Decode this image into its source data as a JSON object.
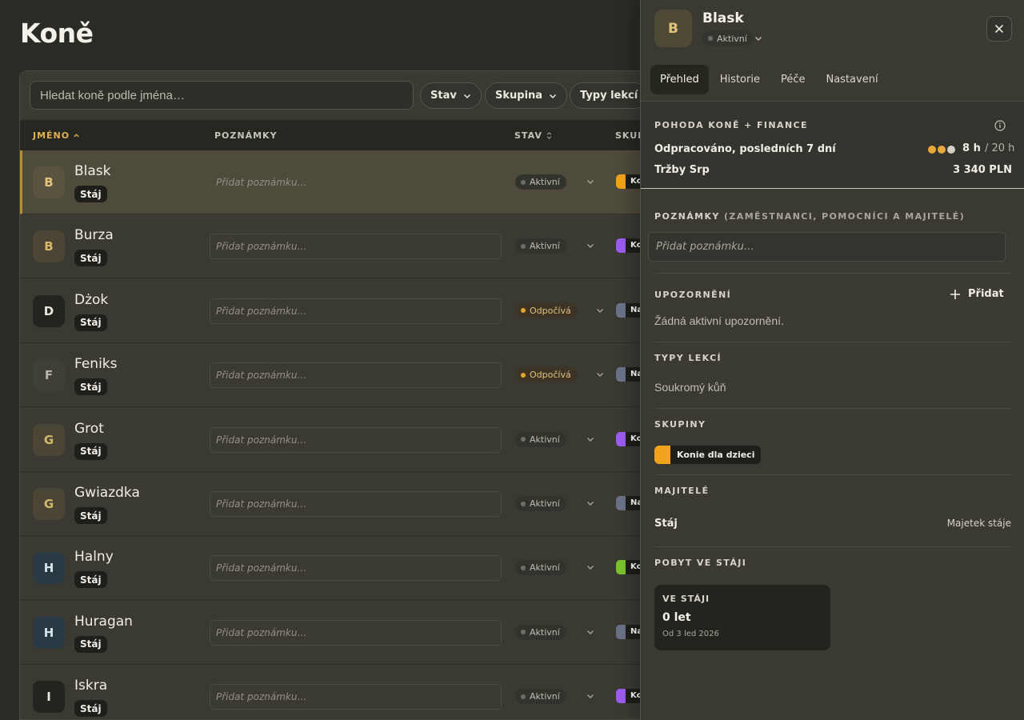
{
  "page": {
    "title": "Koně"
  },
  "toolbar": {
    "search_placeholder": "Hledat koně podle jména…",
    "filters": [
      "Stav",
      "Skupina",
      "Typy lekcí"
    ]
  },
  "table": {
    "columns": {
      "name": "JMÉNO",
      "notes": "POZNÁMKY",
      "status": "STAV",
      "group": "SKUP"
    },
    "note_placeholder": "Přidat poznámku…",
    "rows": [
      {
        "initial": "B",
        "name": "Blask",
        "tag": "Stáj",
        "status": "Aktivní",
        "status_kind": "active",
        "group_label": "Ko",
        "group_color": "#f2a31c",
        "avatar_bg": "#5a5340",
        "avatar_fg": "#e4c27a",
        "selected": true
      },
      {
        "initial": "B",
        "name": "Burza",
        "tag": "Stáj",
        "status": "Aktivní",
        "status_kind": "active",
        "group_label": "Ko",
        "group_color": "#9b5cf0",
        "avatar_bg": "#4a4534",
        "avatar_fg": "#d9b867",
        "selected": false
      },
      {
        "initial": "D",
        "name": "Dżok",
        "tag": "Stáj",
        "status": "Odpočívá",
        "status_kind": "rest",
        "group_label": "Na",
        "group_color": "#6b7287",
        "avatar_bg": "#24241f",
        "avatar_fg": "#e9e6dc",
        "selected": false
      },
      {
        "initial": "F",
        "name": "Feniks",
        "tag": "Stáj",
        "status": "Odpočívá",
        "status_kind": "rest",
        "group_label": "Na",
        "group_color": "#6b7287",
        "avatar_bg": "#3f3f38",
        "avatar_fg": "#b8b4a8",
        "selected": false
      },
      {
        "initial": "G",
        "name": "Grot",
        "tag": "Stáj",
        "status": "Aktivní",
        "status_kind": "active",
        "group_label": "Ko",
        "group_color": "#9b5cf0",
        "avatar_bg": "#4a4534",
        "avatar_fg": "#d9b867",
        "selected": false
      },
      {
        "initial": "G",
        "name": "Gwiazdka",
        "tag": "Stáj",
        "status": "Aktivní",
        "status_kind": "active",
        "group_label": "Na",
        "group_color": "#6b7287",
        "avatar_bg": "#4a4534",
        "avatar_fg": "#d9b867",
        "selected": false
      },
      {
        "initial": "H",
        "name": "Halny",
        "tag": "Stáj",
        "status": "Aktivní",
        "status_kind": "active",
        "group_label": "Ko",
        "group_color": "#7cc42a",
        "avatar_bg": "#2a3a44",
        "avatar_fg": "#d8e4ea",
        "selected": false
      },
      {
        "initial": "H",
        "name": "Huragan",
        "tag": "Stáj",
        "status": "Aktivní",
        "status_kind": "active",
        "group_label": "Na",
        "group_color": "#6b7287",
        "avatar_bg": "#2a3a44",
        "avatar_fg": "#d8e4ea",
        "selected": false
      },
      {
        "initial": "I",
        "name": "Iskra",
        "tag": "Stáj",
        "status": "Aktivní",
        "status_kind": "active",
        "group_label": "Ko",
        "group_color": "#9b5cf0",
        "avatar_bg": "#24241f",
        "avatar_fg": "#e9e6dc",
        "selected": false
      }
    ]
  },
  "panel": {
    "initial": "B",
    "name": "Blask",
    "status": "Aktivní",
    "tabs": [
      "Přehled",
      "Historie",
      "Péče",
      "Nastavení"
    ],
    "active_tab": 0,
    "wellness": {
      "title": "POHODA KONĚ + FINANCE",
      "worked_label": "Odpracováno, posledních 7 dní",
      "worked_hours": "8 h",
      "worked_max": "/ 20 h",
      "worked_fraction": 0.4,
      "revenue_label": "Tržby Srp",
      "revenue_value": "3 340 PLN"
    },
    "notes": {
      "title": "POZNÁMKY",
      "subtitle": "(ZAMĚSTNANCI, POMOCNÍCI A MAJITELÉ)",
      "placeholder": "Přidat poznámku…"
    },
    "alerts": {
      "title": "UPOZORNĚNÍ",
      "add_label": "Přidat",
      "empty": "Žádná aktivní upozornění."
    },
    "lesson_types": {
      "title": "TYPY LEKCÍ",
      "value": "Soukromý kůň"
    },
    "groups": {
      "title": "SKUPINY",
      "items": [
        {
          "label": "Konie dla dzieci",
          "color": "#f2a31c"
        }
      ]
    },
    "owners": {
      "title": "MAJITELÉ",
      "name": "Stáj",
      "type": "Majetek stáje"
    },
    "stay": {
      "title": "POBYT VE STÁJI",
      "label": "VE STÁJI",
      "value": "0 let",
      "since": "Od 3 led 2026"
    }
  }
}
